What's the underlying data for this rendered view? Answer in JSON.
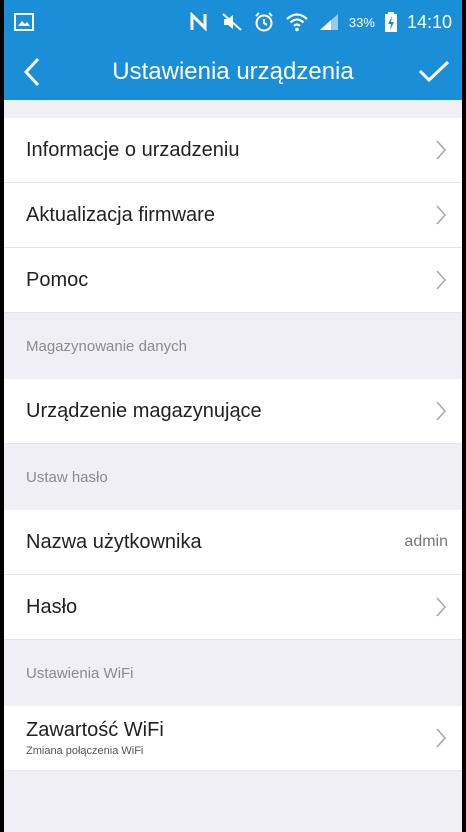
{
  "status_bar": {
    "battery": "33%",
    "time": "14:10"
  },
  "header": {
    "title": "Ustawienia urządzenia"
  },
  "menu": {
    "device_info": "Informacje o urzadzeniu",
    "firmware": "Aktualizacja firmware",
    "help": "Pomoc"
  },
  "storage": {
    "section_label": "Magazynowanie danych",
    "storage_device": "Urządzenie magazynujące"
  },
  "password": {
    "section_label": "Ustaw hasło",
    "username_label": "Nazwa użytkownika",
    "username_value": "admin",
    "password_label": "Hasło"
  },
  "wifi": {
    "section_label": "Ustawienia WiFi",
    "content_label": "Zawartość WiFi",
    "content_sub": "Zmiana połączenia WiFi"
  },
  "colors": {
    "accent": "#1a8fd8",
    "background": "#f0eff5"
  }
}
